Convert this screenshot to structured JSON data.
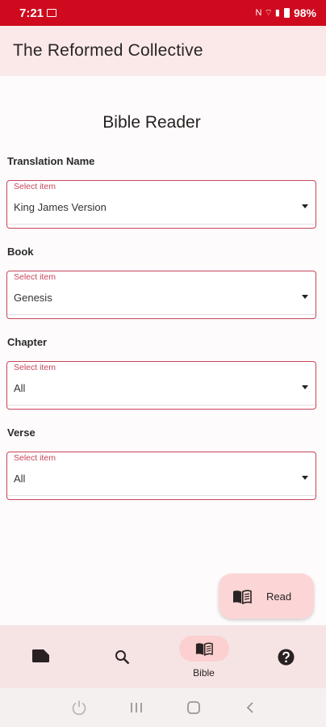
{
  "status_bar": {
    "time": "7:21",
    "signal_glyphs": "N ⌔ ▮",
    "battery": "98%"
  },
  "app_bar": {
    "title": "The Reformed Collective"
  },
  "page": {
    "title": "Bible Reader"
  },
  "fields": [
    {
      "label": "Translation Name",
      "hint": "Select item",
      "value": "King James Version"
    },
    {
      "label": "Book",
      "hint": "Select item",
      "value": "Genesis"
    },
    {
      "label": "Chapter",
      "hint": "Select item",
      "value": "All"
    },
    {
      "label": "Verse",
      "hint": "Select item",
      "value": "All"
    }
  ],
  "fab": {
    "label": "Read",
    "icon": "book-icon"
  },
  "bottom_nav": {
    "items": [
      {
        "icon": "label-icon",
        "label": ""
      },
      {
        "icon": "search-icon",
        "label": ""
      },
      {
        "icon": "bible-icon",
        "label": "Bible",
        "selected": true
      },
      {
        "icon": "help-icon",
        "label": ""
      }
    ]
  },
  "system_nav": [
    "power-icon",
    "recent-apps-icon",
    "home-icon",
    "back-icon"
  ],
  "colors": {
    "status_bar": "#cf0a1e",
    "accent": "#c8455a",
    "app_bar": "#fbe9e9",
    "fab": "#fcd6d6"
  }
}
